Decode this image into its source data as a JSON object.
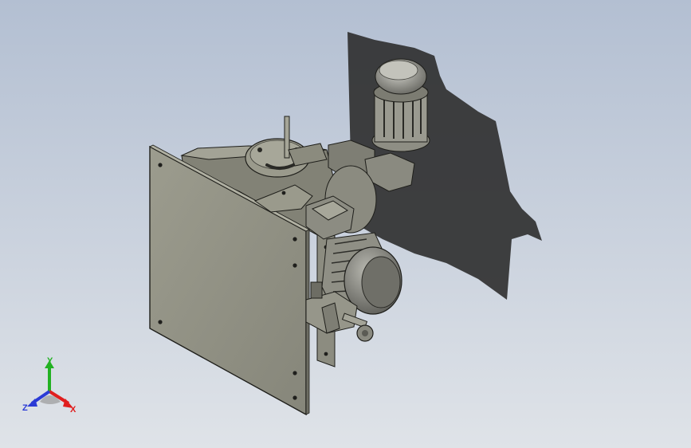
{
  "viewport": {
    "background_top": "#b3bfd2",
    "background_bottom": "#dfe3e8"
  },
  "model": {
    "body_color": "#8e8e80",
    "edge_color": "#1e1e1a",
    "shadow_color": "#2a2a2a"
  },
  "triad": {
    "x_label": "X",
    "y_label": "Y",
    "z_label": "Z",
    "x_color": "#e01e1e",
    "y_color": "#22b122",
    "z_color": "#2b3bd6"
  }
}
